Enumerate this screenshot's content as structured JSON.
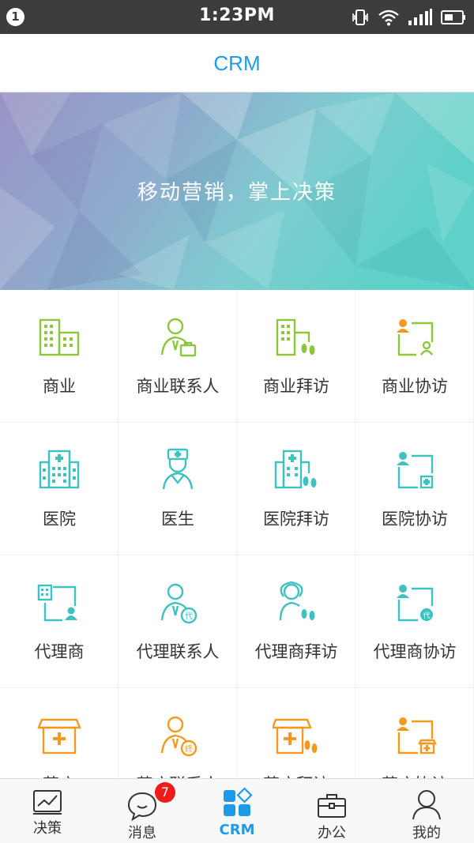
{
  "status_bar": {
    "notification_count": "1",
    "time": "1:23PM",
    "icons": [
      "vibrate-icon",
      "wifi-icon",
      "signal-icon",
      "battery-icon"
    ]
  },
  "header": {
    "title": "CRM"
  },
  "banner": {
    "slogan": "移动营销，掌上决策"
  },
  "colors": {
    "accent": "#1e9be8",
    "green": "#8cc63f",
    "teal": "#3ec1c0",
    "orange": "#f39a1e",
    "badge": "#ee1b1b"
  },
  "grid": {
    "items": [
      {
        "label": "商业",
        "icon": "building-icon"
      },
      {
        "label": "商业联系人",
        "icon": "contact-briefcase-icon"
      },
      {
        "label": "商业拜访",
        "icon": "building-footprints-icon"
      },
      {
        "label": "商业协访",
        "icon": "co-visit-icon"
      },
      {
        "label": "医院",
        "icon": "hospital-icon"
      },
      {
        "label": "医生",
        "icon": "doctor-icon"
      },
      {
        "label": "医院拜访",
        "icon": "hospital-footprints-icon"
      },
      {
        "label": "医院协访",
        "icon": "hospital-co-visit-icon"
      },
      {
        "label": "代理商",
        "icon": "agent-icon"
      },
      {
        "label": "代理联系人",
        "icon": "agent-contact-icon"
      },
      {
        "label": "代理商拜访",
        "icon": "agent-visit-icon"
      },
      {
        "label": "代理商协访",
        "icon": "agent-co-visit-icon"
      },
      {
        "label": "药店",
        "icon": "pharmacy-icon"
      },
      {
        "label": "药店联系人",
        "icon": "pharmacy-contact-icon"
      },
      {
        "label": "药店拜访",
        "icon": "pharmacy-visit-icon"
      },
      {
        "label": "药店协访",
        "icon": "pharmacy-co-visit-icon"
      }
    ]
  },
  "tab_bar": {
    "tabs": [
      {
        "label": "决策",
        "icon": "chart-icon"
      },
      {
        "label": "消息",
        "icon": "chat-bubble-icon",
        "badge": "7"
      },
      {
        "label": "CRM",
        "icon": "crm-apps-icon",
        "active": true
      },
      {
        "label": "办公",
        "icon": "briefcase-icon"
      },
      {
        "label": "我的",
        "icon": "person-icon"
      }
    ]
  }
}
